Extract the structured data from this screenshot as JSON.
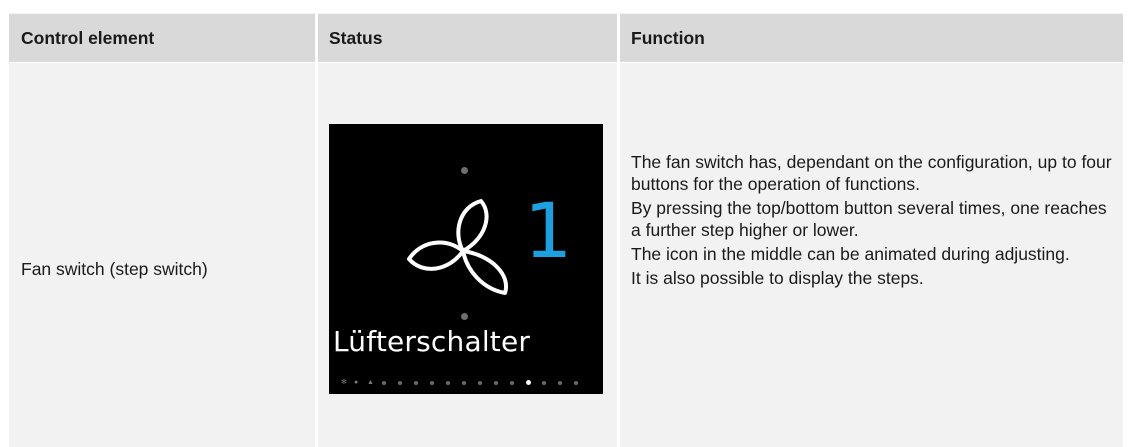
{
  "table": {
    "headers": {
      "control_element": "Control element",
      "status": "Status",
      "function": "Function"
    },
    "row": {
      "control_element": "Fan switch (step switch)",
      "display": {
        "step_number": "1",
        "label": "Lüfterschalter",
        "step_color": "#1e9fe0",
        "background": "#000000",
        "page_dots_total": 14,
        "active_page_dot": 10,
        "icons": [
          "fan-icon",
          "page-indicator-dots"
        ]
      },
      "function_paragraphs": [
        "The fan switch has, dependant on the configuration, up to four buttons for the operation of functions.",
        "By pressing the top/bottom button several times, one reaches a further step higher or lower.",
        "The icon in the middle can be animated during adjusting.",
        "It is also possible to display the steps."
      ]
    }
  },
  "colors": {
    "header_bg": "#d9d9d9",
    "body_bg": "#f2f2f2",
    "separator": "#ffffff"
  }
}
